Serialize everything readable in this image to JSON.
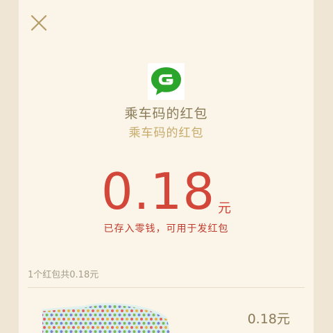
{
  "header": {
    "close_icon": "close-icon"
  },
  "sender": {
    "logo_icon": "green-g-logo-icon",
    "name": "乘车码的红包",
    "greeting": "乘车码的红包"
  },
  "amount": {
    "value": "0.18",
    "unit": "元",
    "note": "已存入零钱，可用于发红包"
  },
  "claims": {
    "summary": "1个红包共0.18元",
    "items": [
      {
        "avatar_icon": "polka-dot-avatar-icon",
        "amount": "0.18元"
      }
    ]
  },
  "colors": {
    "background": "#efe6d5",
    "card": "#faf5e8",
    "amount_red": "#d3473b",
    "title_brown": "#8a7a58",
    "greeting_gold": "#c7aa6b",
    "logo_green": "#2ba52b"
  }
}
